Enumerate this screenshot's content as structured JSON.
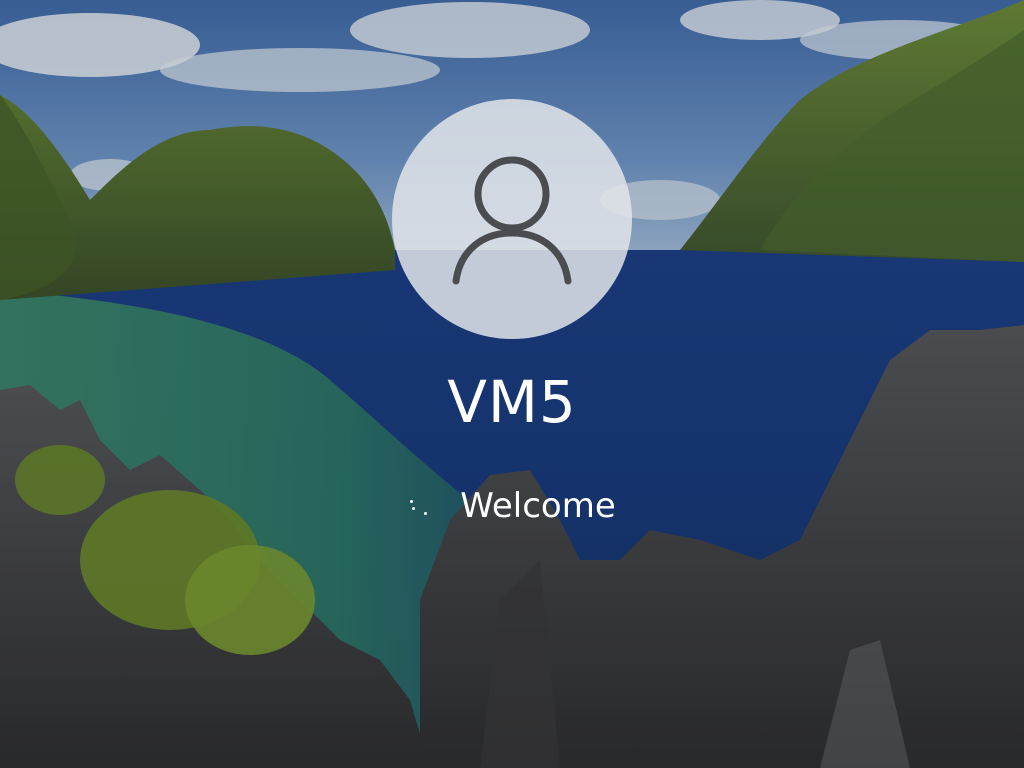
{
  "user": {
    "name": "VM5",
    "avatar_icon": "user-account-icon"
  },
  "status": {
    "text": "Welcome",
    "indicator_icon": "loading-spinner-icon"
  },
  "background": {
    "description_icon": "lock-screen-wallpaper"
  },
  "colors": {
    "text": "#ffffff",
    "avatar_fill": "#e1e4e9",
    "avatar_icon": "#4a4c50"
  }
}
